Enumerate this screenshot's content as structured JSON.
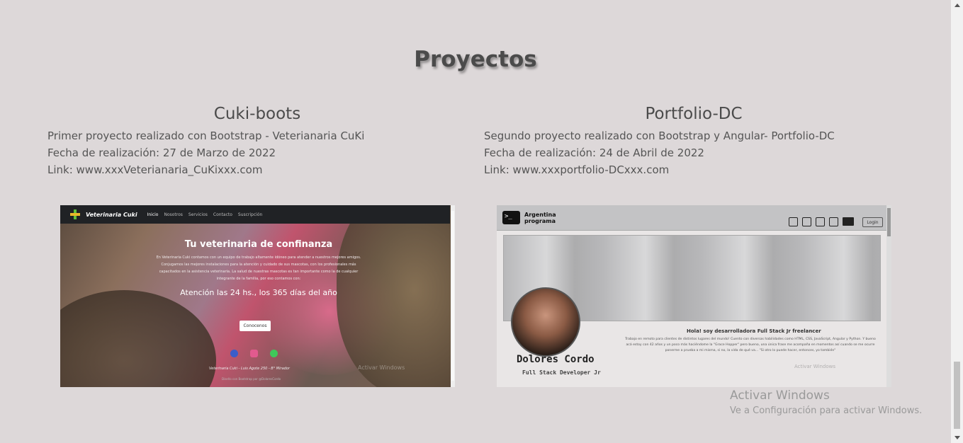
{
  "section": {
    "title": "Proyectos"
  },
  "projects": [
    {
      "title": "Cuki-boots",
      "description": "Primer proyecto realizado con Bootstrap - Veterianaria CuKi",
      "date": "Fecha de realización: 27 de Marzo de 2022",
      "link": "Link: www.xxxVeterianaria_CuKixxx.com",
      "preview": {
        "brand": "Veterinaria Cuki",
        "nav": [
          "Inicio",
          "Nosotros",
          "Servicios",
          "Contacto",
          "Suscripción"
        ],
        "hero_title": "Tu veterinaria de confinanza",
        "hero_body": "En Veterinaria Cuki contamos con un equipo de trabajo altamente idóneo para atender a nuestros mejores amigos. Conjugamos las mejores instalaciones para la atención y cuidado de sus mascotas, con los profesionales más capacitados en la asistencia veterinaria. La salud de nuestras mascotas es tan importante como la de cualquier integrante de la familia, por eso contamos con:",
        "hours": "Atención las 24 hs., los 365 días del año",
        "button": "Conocenos",
        "footer": "Veterinaria Cuki - Luis Agote 250 - B° Mirador",
        "credit": "Diseño con Bootstrap por @DoloresCordo",
        "watermark": "Activar Windows"
      }
    },
    {
      "title": "Portfolio-DC",
      "description": "Segundo proyecto realizado con Bootstrap y Angular- Portfolio-DC",
      "date": "Fecha de realización: 24 de Abril de 2022",
      "link": "Link: www.xxxportfolio-DCxxx.com",
      "preview": {
        "logo_glyph": ">_",
        "logo_line1": "Argentina",
        "logo_line2": "programa",
        "login": "Login",
        "name": "Dolores Cordo",
        "role": "Full Stack Developer Jr",
        "greeting": "Hola! soy desarrolladora Full Stack Jr freelancer",
        "bio": "Trabajo en remoto para clientes de distintos lugares del mundo! Cuento con diversas habilidades como HTML, CSS, JavaScript, Angular y Python. Y bueno acá estoy con 42 años y un poco más haciéndome la \"Grace Hopper\" pero bueno, una única frase me acompaña en momentos así cuando se me ocurre ponerme a prueba a mi misma, si no, la vida de qué va... \"Si otro lo puede hacer, entonces, yo también\"",
        "watermark": "Activar Windows"
      }
    }
  ],
  "os_watermark": {
    "line1": "Activar Windows",
    "line2": "Ve a Configuración para activar Windows."
  }
}
